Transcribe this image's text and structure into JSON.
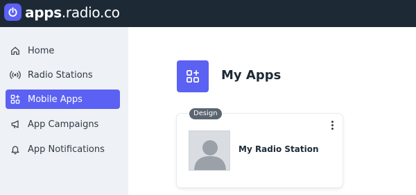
{
  "header": {
    "brand": "apps",
    "domain": ".radio.co",
    "logo_icon": "power-icon"
  },
  "sidebar": {
    "items": [
      {
        "label": "Home",
        "icon": "home-icon",
        "active": false
      },
      {
        "label": "Radio Stations",
        "icon": "broadcast-icon",
        "active": false
      },
      {
        "label": "Mobile Apps",
        "icon": "apps-grid-icon",
        "active": true
      },
      {
        "label": "App Campaigns",
        "icon": "megaphone-icon",
        "active": false
      },
      {
        "label": "App Notifications",
        "icon": "bell-icon",
        "active": false
      }
    ]
  },
  "main": {
    "title": "My Apps",
    "title_icon": "apps-grid-icon",
    "cards": [
      {
        "badge": "Design",
        "name": "My Radio Station",
        "image": "placeholder-avatar"
      }
    ]
  },
  "colors": {
    "accent": "#5b61f2",
    "topbar": "#1d2a36",
    "sidebar": "#eef1f5"
  }
}
